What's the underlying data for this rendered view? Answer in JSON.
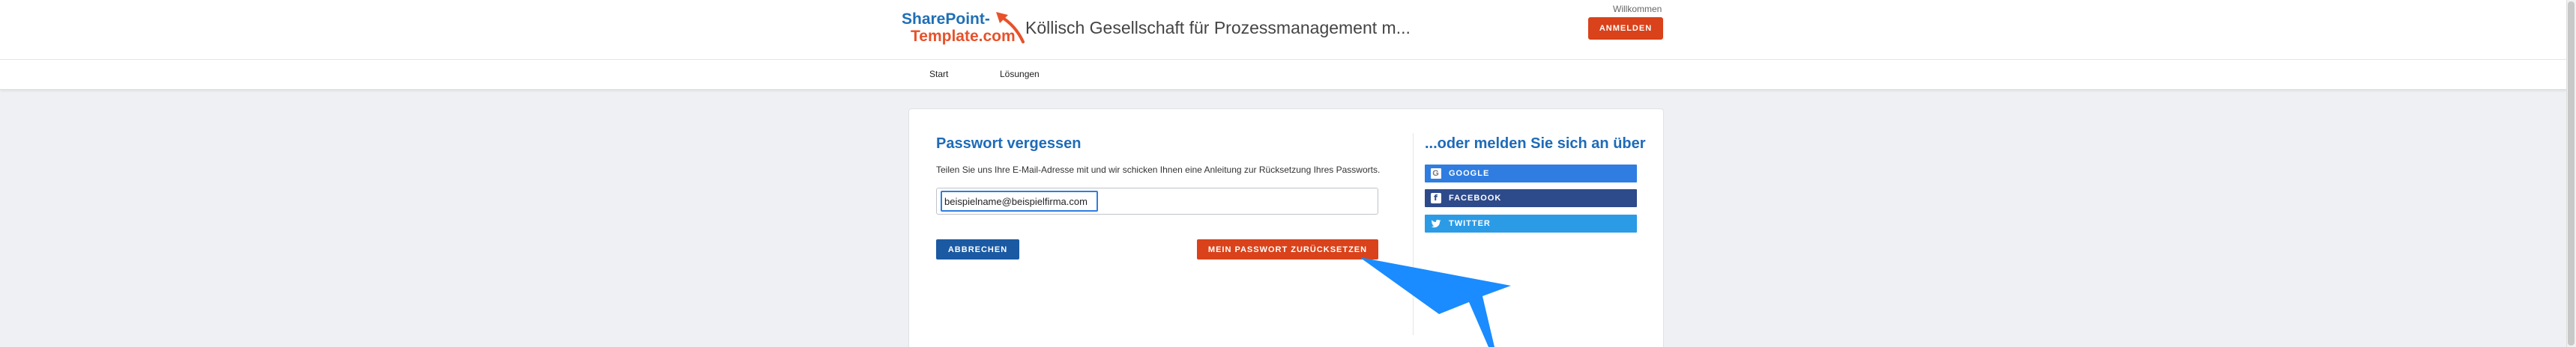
{
  "header": {
    "logo": {
      "line1": "SharePoint-",
      "line2": "Template.com"
    },
    "site_title": "Köllisch Gesellschaft für Prozessmanagement m...",
    "welcome": "Willkommen",
    "login_label": "ANMELDEN"
  },
  "nav": {
    "items": [
      {
        "label": "Start"
      },
      {
        "label": "Lösungen"
      }
    ]
  },
  "forgot_password": {
    "title": "Passwort vergessen",
    "description": "Teilen Sie uns Ihre E-Mail-Adresse mit und wir schicken Ihnen eine Anleitung zur Rücksetzung Ihres Passworts.",
    "email_value": "beispielname@beispielfirma.com",
    "cancel_label": "ABBRECHEN",
    "reset_label": "MEIN PASSWORT ZURÜCKSETZEN"
  },
  "alternative_login": {
    "title": "...oder melden Sie sich an über",
    "providers": [
      {
        "label": "GOOGLE",
        "icon": "google-icon",
        "color": "#2f7de1"
      },
      {
        "label": "FACEBOOK",
        "icon": "facebook-icon",
        "color": "#2d4a8a"
      },
      {
        "label": "TWITTER",
        "icon": "twitter-icon",
        "color": "#2c9be6"
      }
    ]
  },
  "colors": {
    "accent_orange": "#d9421a",
    "primary_blue": "#1e6bb8",
    "annotation_arrow": "#1a8cff"
  }
}
